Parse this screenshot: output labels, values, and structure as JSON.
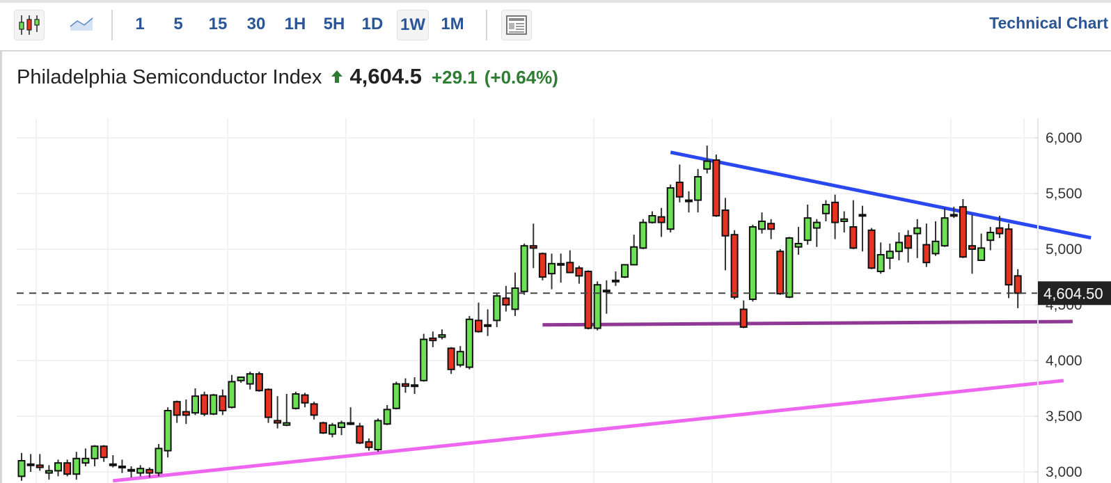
{
  "toolbar": {
    "chart_types": [
      {
        "name": "candlestick-chart-icon",
        "active": true
      },
      {
        "name": "area-chart-icon",
        "active": false
      }
    ],
    "intervals": [
      "1",
      "5",
      "15",
      "30",
      "1H",
      "5H",
      "1D",
      "1W",
      "1M"
    ],
    "active_interval": "1W",
    "layout_icon": "layout-icon",
    "technical_chart_link": "Technical Chart"
  },
  "quote": {
    "name": "Philadelphia Semiconductor Index",
    "direction": "up",
    "price": "4,604.5",
    "change": "+29.1",
    "change_pct": "(+0.64%)"
  },
  "colors": {
    "accent": "#2a5597",
    "up": "#6ee055",
    "down": "#e63322",
    "positive_text": "#2e7d32",
    "trend_upper": "#1f3ff0",
    "trend_support": "#8b2f8f",
    "trend_lower": "#ee5ef0"
  },
  "chart_data": {
    "type": "candlestick",
    "title": "Philadelphia Semiconductor Index",
    "interval": "1W",
    "ylim": [
      2900,
      6200
    ],
    "yticks": [
      3000,
      3500,
      4000,
      4500,
      5000,
      5500,
      6000
    ],
    "ytick_labels": [
      "3,000",
      "3,500",
      "4,000",
      "4,500",
      "5,000",
      "5,500",
      "6,000"
    ],
    "grid": true,
    "last_price": 4604.5,
    "last_price_label": "4,604.50",
    "candles": [
      [
        2960,
        3100,
        3170,
        2920
      ],
      [
        3070,
        3060,
        3160,
        3000
      ],
      [
        3060,
        3040,
        3160,
        3010
      ],
      [
        2990,
        3010,
        3060,
        2930
      ],
      [
        3010,
        3080,
        3110,
        2960
      ],
      [
        3080,
        2980,
        3110,
        2960
      ],
      [
        2980,
        3120,
        3180,
        2930
      ],
      [
        3080,
        3120,
        3210,
        3050
      ],
      [
        3120,
        3230,
        3240,
        3050
      ],
      [
        3230,
        3130,
        3240,
        3090
      ],
      [
        3070,
        3070,
        3150,
        3040
      ],
      [
        3050,
        3050,
        3110,
        2990
      ],
      [
        3020,
        3010,
        3050,
        2950
      ],
      [
        2990,
        3030,
        3060,
        2960
      ],
      [
        3020,
        2990,
        3040,
        2950
      ],
      [
        2990,
        3210,
        3250,
        2960
      ],
      [
        3190,
        3550,
        3580,
        3130
      ],
      [
        3630,
        3510,
        3640,
        3440
      ],
      [
        3540,
        3510,
        3650,
        3430
      ],
      [
        3530,
        3680,
        3750,
        3510
      ],
      [
        3690,
        3520,
        3720,
        3500
      ],
      [
        3520,
        3690,
        3700,
        3510
      ],
      [
        3680,
        3550,
        3740,
        3510
      ],
      [
        3580,
        3810,
        3870,
        3570
      ],
      [
        3820,
        3850,
        3850,
        3800
      ],
      [
        3790,
        3880,
        3900,
        3740
      ],
      [
        3880,
        3730,
        3900,
        3720
      ],
      [
        3740,
        3490,
        3750,
        3440
      ],
      [
        3460,
        3440,
        3680,
        3390
      ],
      [
        3420,
        3440,
        3700,
        3410
      ],
      [
        3570,
        3700,
        3720,
        3560
      ],
      [
        3690,
        3620,
        3710,
        3580
      ],
      [
        3610,
        3510,
        3630,
        3470
      ],
      [
        3440,
        3350,
        3450,
        3340
      ],
      [
        3340,
        3420,
        3440,
        3310
      ],
      [
        3400,
        3440,
        3460,
        3330
      ],
      [
        3440,
        3430,
        3580,
        3420
      ],
      [
        3410,
        3260,
        3440,
        3250
      ],
      [
        3270,
        3220,
        3300,
        3190
      ],
      [
        3200,
        3460,
        3480,
        3180
      ],
      [
        3430,
        3560,
        3600,
        3420
      ],
      [
        3570,
        3790,
        3810,
        3560
      ],
      [
        3790,
        3770,
        3840,
        3710
      ],
      [
        3770,
        3780,
        3850,
        3700
      ],
      [
        3820,
        4190,
        4240,
        3810
      ],
      [
        4200,
        4180,
        4260,
        4120
      ],
      [
        4210,
        4230,
        4280,
        4190
      ],
      [
        4110,
        3920,
        4120,
        3880
      ],
      [
        3960,
        4080,
        4130,
        3940
      ],
      [
        3940,
        4370,
        4400,
        3920
      ],
      [
        4360,
        4260,
        4520,
        4250
      ],
      [
        4320,
        4320,
        4460,
        4220
      ],
      [
        4360,
        4580,
        4600,
        4300
      ],
      [
        4560,
        4500,
        4670,
        4440
      ],
      [
        4460,
        4650,
        4790,
        4400
      ],
      [
        4620,
        5030,
        5050,
        4590
      ],
      [
        5030,
        5010,
        5230,
        4830
      ],
      [
        4960,
        4750,
        4970,
        4720
      ],
      [
        4780,
        4870,
        4960,
        4640
      ],
      [
        4870,
        4860,
        4960,
        4700
      ],
      [
        4880,
        4790,
        4990,
        4790
      ],
      [
        4830,
        4760,
        4850,
        4690
      ],
      [
        4800,
        4290,
        4810,
        4280
      ],
      [
        4290,
        4680,
        4710,
        4270
      ],
      [
        4630,
        4620,
        4720,
        4420
      ],
      [
        4710,
        4720,
        4800,
        4670
      ],
      [
        4750,
        4860,
        4860,
        4740
      ],
      [
        4860,
        5020,
        5130,
        4860
      ],
      [
        5010,
        5240,
        5270,
        5000
      ],
      [
        5240,
        5300,
        5340,
        5230
      ],
      [
        5290,
        5240,
        5370,
        5110
      ],
      [
        5180,
        5550,
        5580,
        5150
      ],
      [
        5600,
        5470,
        5760,
        5420
      ],
      [
        5440,
        5430,
        5520,
        5330
      ],
      [
        5440,
        5650,
        5720,
        5330
      ],
      [
        5720,
        5790,
        5930,
        5680
      ],
      [
        5800,
        5300,
        5850,
        5290
      ],
      [
        5350,
        5120,
        5460,
        4810
      ],
      [
        5130,
        4570,
        5170,
        4550
      ],
      [
        4460,
        4300,
        4540,
        4290
      ],
      [
        4550,
        5200,
        5220,
        4530
      ],
      [
        5180,
        5250,
        5330,
        5140
      ],
      [
        5230,
        5180,
        5270,
        5090
      ],
      [
        4980,
        4600,
        5000,
        4590
      ],
      [
        4570,
        5100,
        5110,
        4560
      ],
      [
        5020,
        5050,
        5200,
        4950
      ],
      [
        5080,
        5280,
        5400,
        5040
      ],
      [
        5190,
        5240,
        5270,
        5020
      ],
      [
        5320,
        5400,
        5440,
        5250
      ],
      [
        5420,
        5240,
        5490,
        5090
      ],
      [
        5250,
        5270,
        5340,
        5150
      ],
      [
        5200,
        5010,
        5440,
        5000
      ],
      [
        5300,
        5310,
        5390,
        4980
      ],
      [
        5170,
        4830,
        5190,
        4820
      ],
      [
        4800,
        4950,
        5060,
        4780
      ],
      [
        4920,
        4980,
        5050,
        4820
      ],
      [
        4980,
        5060,
        5150,
        4900
      ],
      [
        5120,
        5010,
        5170,
        4880
      ],
      [
        5140,
        5190,
        5270,
        4920
      ],
      [
        5040,
        4880,
        5230,
        4840
      ],
      [
        4960,
        5070,
        5250,
        4940
      ],
      [
        5030,
        5280,
        5370,
        5020
      ],
      [
        5310,
        5310,
        5380,
        5280
      ],
      [
        5380,
        4930,
        5450,
        4920
      ],
      [
        5030,
        5000,
        5310,
        4780
      ],
      [
        4900,
        5010,
        5140,
        4900
      ],
      [
        5080,
        5150,
        5200,
        4990
      ],
      [
        5190,
        5140,
        5300,
        5100
      ],
      [
        5180,
        4680,
        5230,
        4560
      ],
      [
        4760,
        4604.5,
        4820,
        4470
      ]
    ],
    "trendlines": [
      {
        "name": "upper-resistance",
        "color": "#1f3ff0",
        "from_index": 71,
        "from_price": 5870,
        "to_index": 117,
        "to_price": 5102
      },
      {
        "name": "support",
        "color": "#8b2f8f",
        "from_index": 57,
        "from_price": 4320,
        "to_index": 115,
        "to_price": 4350
      },
      {
        "name": "lower-rising",
        "color": "#ee5ef0",
        "from_index": 10,
        "from_price": 2920,
        "to_index": 114,
        "to_price": 3820
      }
    ]
  }
}
